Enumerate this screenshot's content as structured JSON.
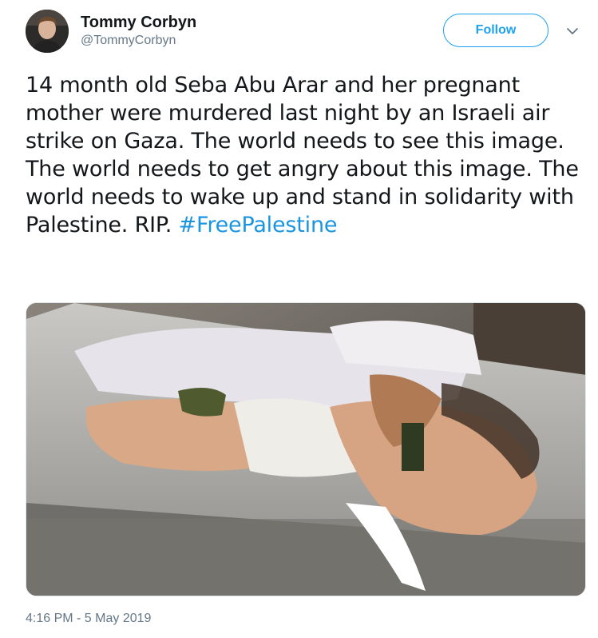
{
  "author": {
    "display_name": "Tommy Corbyn",
    "handle": "@TommyCorbyn",
    "avatar_icon": "avatar-photo"
  },
  "actions": {
    "follow_label": "Follow",
    "menu_icon": "chevron-down-icon"
  },
  "tweet": {
    "text": "14 month old Seba Abu Arar and her pregnant mother were murdered last night by an Israeli air strike on Gaza. The world needs to see this image. The world needs to get angry about this image. The world needs to wake up and stand in solidarity with Palestine. RIP. ",
    "hashtag": "#FreePalestine",
    "timestamp": "4:16 PM - 5 May 2019"
  },
  "colors": {
    "accent": "#1da1f2",
    "hashtag": "#1b95e0",
    "secondary_text": "#657786",
    "primary_text": "#14171a"
  }
}
